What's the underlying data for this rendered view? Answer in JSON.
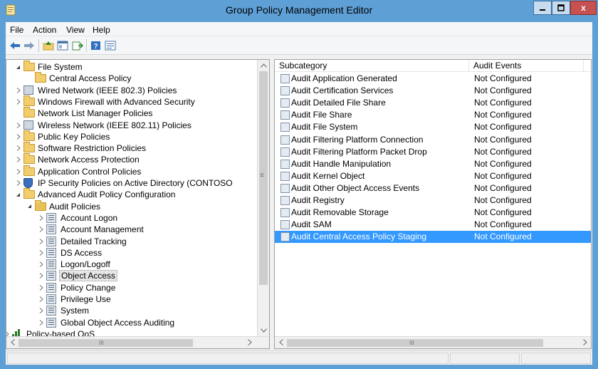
{
  "window": {
    "title": "Group Policy Management Editor",
    "close_glyph": "x"
  },
  "menu": [
    "File",
    "Action",
    "View",
    "Help"
  ],
  "toolbar": {
    "icons": [
      "back-arrow-icon",
      "forward-arrow-icon",
      "up-folder-icon",
      "show-hide-tree-icon",
      "export-list-icon",
      "help-icon",
      "properties-icon"
    ]
  },
  "tree": [
    {
      "label": "File System",
      "level": 3,
      "arrow": "expanded",
      "icon": "folder-icon"
    },
    {
      "label": "Central Access Policy",
      "level": 4,
      "arrow": "none",
      "icon": "folder-icon"
    },
    {
      "label": "Wired Network (IEEE 802.3) Policies",
      "level": 3,
      "arrow": "collapsed",
      "icon": "network-icon"
    },
    {
      "label": "Windows Firewall with Advanced Security",
      "level": 3,
      "arrow": "collapsed",
      "icon": "folder-icon"
    },
    {
      "label": "Network List Manager Policies",
      "level": 3,
      "arrow": "none",
      "icon": "folder-icon"
    },
    {
      "label": "Wireless Network (IEEE 802.11) Policies",
      "level": 3,
      "arrow": "collapsed",
      "icon": "network-icon"
    },
    {
      "label": "Public Key Policies",
      "level": 3,
      "arrow": "collapsed",
      "icon": "folder-icon"
    },
    {
      "label": "Software Restriction Policies",
      "level": 3,
      "arrow": "collapsed",
      "icon": "folder-icon"
    },
    {
      "label": "Network Access Protection",
      "level": 3,
      "arrow": "collapsed",
      "icon": "folder-icon"
    },
    {
      "label": "Application Control Policies",
      "level": 3,
      "arrow": "collapsed",
      "icon": "folder-icon"
    },
    {
      "label": "IP Security Policies on Active Directory (CONTOSO",
      "level": 3,
      "arrow": "collapsed",
      "icon": "shield-icon"
    },
    {
      "label": "Advanced Audit Policy Configuration",
      "level": 3,
      "arrow": "expanded",
      "icon": "folder-icon"
    },
    {
      "label": "Audit Policies",
      "level": 4,
      "arrow": "expanded",
      "icon": "audit-folder-icon"
    },
    {
      "label": "Account Logon",
      "level": 5,
      "arrow": "collapsed",
      "icon": "policy-icon"
    },
    {
      "label": "Account Management",
      "level": 5,
      "arrow": "collapsed",
      "icon": "policy-icon"
    },
    {
      "label": "Detailed Tracking",
      "level": 5,
      "arrow": "collapsed",
      "icon": "policy-icon"
    },
    {
      "label": "DS Access",
      "level": 5,
      "arrow": "collapsed",
      "icon": "policy-icon"
    },
    {
      "label": "Logon/Logoff",
      "level": 5,
      "arrow": "collapsed",
      "icon": "policy-icon"
    },
    {
      "label": "Object Access",
      "level": 5,
      "arrow": "collapsed",
      "icon": "policy-icon",
      "selected": true
    },
    {
      "label": "Policy Change",
      "level": 5,
      "arrow": "collapsed",
      "icon": "policy-icon"
    },
    {
      "label": "Privilege Use",
      "level": 5,
      "arrow": "collapsed",
      "icon": "policy-icon"
    },
    {
      "label": "System",
      "level": 5,
      "arrow": "collapsed",
      "icon": "policy-icon"
    },
    {
      "label": "Global Object Access Auditing",
      "level": 5,
      "arrow": "collapsed",
      "icon": "policy-icon"
    },
    {
      "label": "Policy-based QoS",
      "level": 2,
      "arrow": "collapsed",
      "icon": "qos-icon"
    }
  ],
  "list": {
    "columns": [
      "Subcategory",
      "Audit Events"
    ],
    "rows": [
      {
        "name": "Audit Application Generated",
        "value": "Not Configured"
      },
      {
        "name": "Audit Certification Services",
        "value": "Not Configured"
      },
      {
        "name": "Audit Detailed File Share",
        "value": "Not Configured"
      },
      {
        "name": "Audit File Share",
        "value": "Not Configured"
      },
      {
        "name": "Audit File System",
        "value": "Not Configured"
      },
      {
        "name": "Audit Filtering Platform Connection",
        "value": "Not Configured"
      },
      {
        "name": "Audit Filtering Platform Packet Drop",
        "value": "Not Configured"
      },
      {
        "name": "Audit Handle Manipulation",
        "value": "Not Configured"
      },
      {
        "name": "Audit Kernel Object",
        "value": "Not Configured"
      },
      {
        "name": "Audit Other Object Access Events",
        "value": "Not Configured"
      },
      {
        "name": "Audit Registry",
        "value": "Not Configured"
      },
      {
        "name": "Audit Removable Storage",
        "value": "Not Configured"
      },
      {
        "name": "Audit SAM",
        "value": "Not Configured"
      },
      {
        "name": "Audit Central Access Policy Staging",
        "value": "Not Configured",
        "selected": true
      }
    ]
  },
  "scroll_glyphs": {
    "grip": "≡",
    "hgrip": "III"
  },
  "colors": {
    "title_bar": "#5ea0d6",
    "selection": "#3399ff",
    "close_button": "#c75050"
  }
}
